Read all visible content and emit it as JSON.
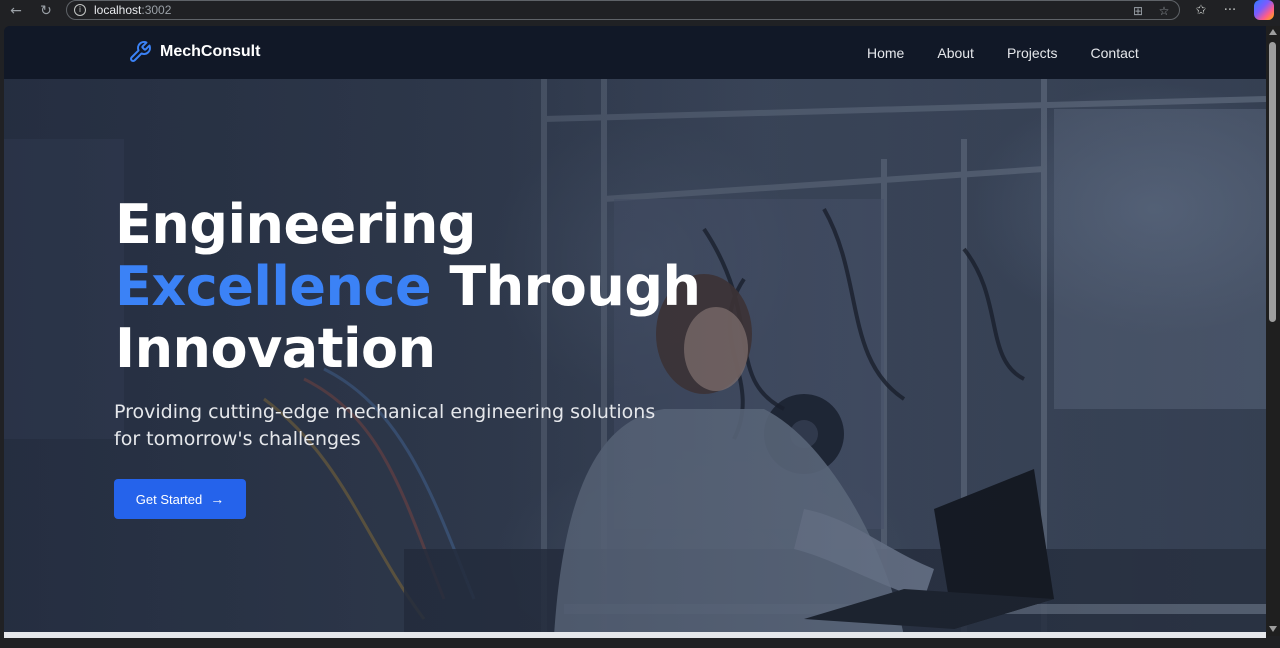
{
  "browser": {
    "url_host": "localhost",
    "url_port": ":3002",
    "icons": {
      "back": "arrow-left-icon",
      "reload": "reload-icon",
      "info": "info-icon",
      "split": "split-screen-icon",
      "favorite": "star-icon",
      "favorites_list": "favorites-icon",
      "menu": "more-icon",
      "copilot": "copilot-icon"
    }
  },
  "navbar": {
    "brand": "MechConsult",
    "brand_icon": "wrench-icon",
    "links": [
      "Home",
      "About",
      "Projects",
      "Contact"
    ]
  },
  "hero": {
    "headline_line1": "Engineering",
    "headline_accent": "Excellence",
    "headline_rest": "Through",
    "headline_line3": "Innovation",
    "subtitle": "Providing cutting-edge mechanical engineering solutions for tomorrow's challenges",
    "cta_label": "Get Started",
    "cta_icon": "arrow-right-icon"
  },
  "colors": {
    "navbar_bg": "#111827",
    "accent": "#3b82f6",
    "button": "#2563eb",
    "text": "#ffffff"
  }
}
